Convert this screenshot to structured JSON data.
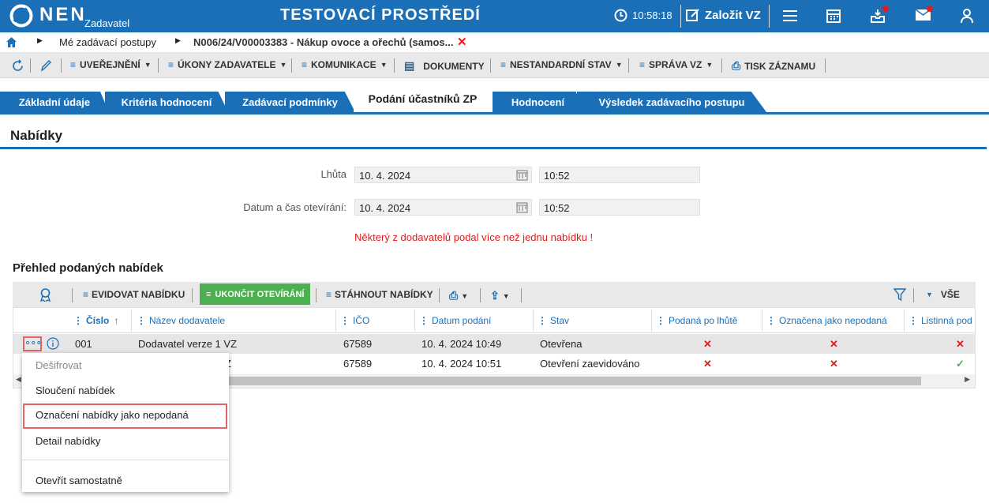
{
  "header": {
    "logo_text": "NEN",
    "logo_sub": "Zadavatel",
    "env_title": "TESTOVACÍ PROSTŘEDÍ",
    "time": "10:58:18",
    "create_label": "Založit VZ"
  },
  "breadcrumb": {
    "items": [
      "Mé zadávací postupy",
      "N006/24/V00003383 - Nákup ovoce a ořechů (samos..."
    ]
  },
  "toolbar": {
    "items": [
      "UVEŘEJNĚNÍ",
      "ÚKONY ZADAVATELE",
      "KOMUNIKACE",
      "DOKUMENTY",
      "NESTANDARDNÍ STAV",
      "SPRÁVA VZ",
      "TISK ZÁZNAMU"
    ]
  },
  "tabs": [
    "Základní údaje",
    "Kritéria hodnocení",
    "Zadávací podmínky",
    "Podání účastníků ZP",
    "Hodnocení",
    "Výsledek zadávacího postupu"
  ],
  "section_title": "Nabídky",
  "form": {
    "deadline_label": "Lhůta",
    "deadline_date": "10. 4. 2024",
    "deadline_time": "10:52",
    "opening_label": "Datum a čas otevírání:",
    "opening_date": "10. 4. 2024",
    "opening_time": "10:52"
  },
  "warning": "Některý z dodavatelů podal více než jednu nabídku !",
  "overview_title": "Přehled podaných nabídek",
  "gridbar": {
    "evidovat": "EVIDOVAT NABÍDKU",
    "ukoncit": "UKONČIT OTEVÍRÁNÍ",
    "stahnout": "STÁHNOUT NABÍDKY",
    "filter_all": "VŠE"
  },
  "table": {
    "headers": [
      "Číslo",
      "Název dodavatele",
      "IČO",
      "Datum podání",
      "Stav",
      "Podaná po lhůtě",
      "Označena jako nepodaná",
      "Listinná pod"
    ],
    "rows": [
      {
        "cislo": "001",
        "nazev": "Dodavatel verze 1 VZ",
        "ico": "67589",
        "datum": "10. 4. 2024 10:49",
        "stav": "Otevřena"
      },
      {
        "cislo": "",
        "nazev": "Z",
        "ico": "67589",
        "datum": "10. 4. 2024 10:51",
        "stav": "Otevření zaevidováno"
      }
    ]
  },
  "context_menu": {
    "items": [
      "Dešifrovat",
      "Sloučení nabídek",
      "Označení nabídky jako nepodaná",
      "Detail nabídky",
      "Otevřít samostatně"
    ]
  },
  "colors": {
    "brand": "#1a6fb7",
    "error": "#e31b1b",
    "success": "#4caf50"
  }
}
